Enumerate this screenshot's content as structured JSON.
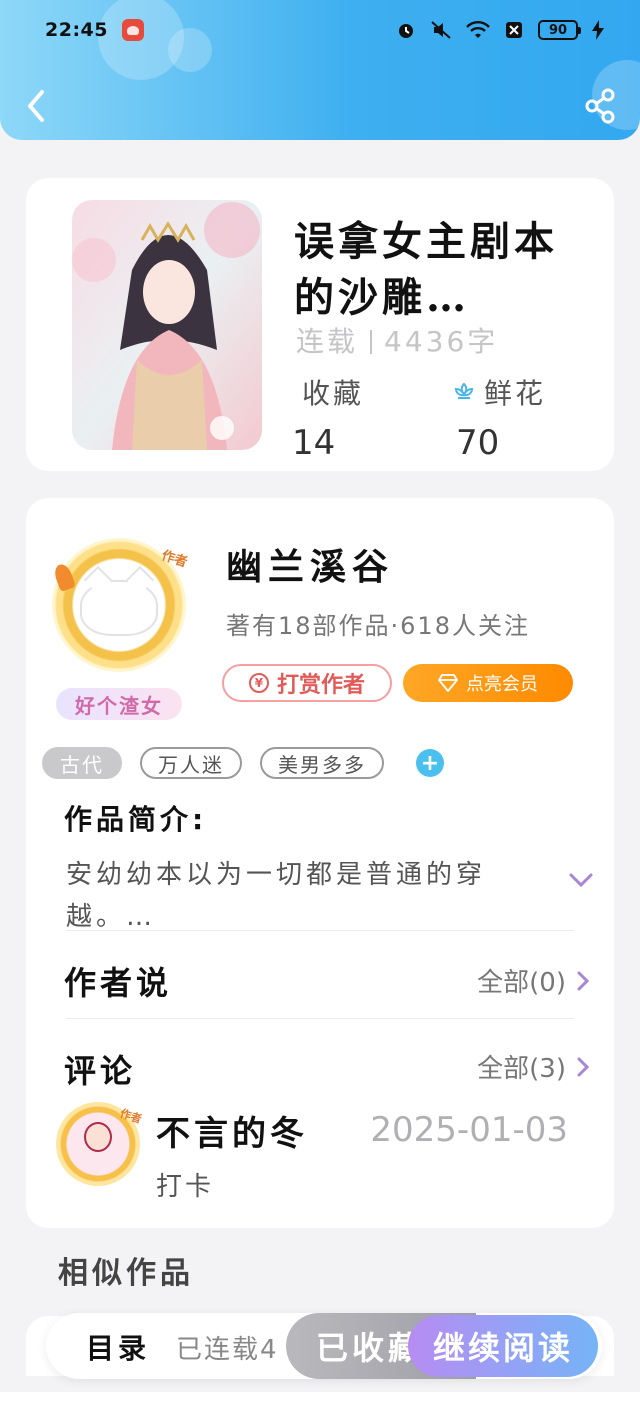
{
  "status_bar": {
    "time": "22:45",
    "battery": "90"
  },
  "header": {
    "back_icon": "chevron-left-icon",
    "share_icon": "share-icon"
  },
  "book": {
    "title": "误拿女主剧本的沙雕…",
    "status": "连载",
    "word_count": "4436字",
    "favorites_label": "收藏",
    "favorites_value": "14",
    "flowers_label": "鲜花",
    "flowers_value": "70"
  },
  "author": {
    "name": "幽兰溪谷",
    "info": "著有18部作品·618人关注",
    "avatar_tag": "作者",
    "badge": "好个渣女",
    "reward_label": "打赏作者",
    "vip_label": "点亮会员"
  },
  "tags": [
    "古代",
    "万人迷",
    "美男多多"
  ],
  "intro": {
    "title": "作品简介:",
    "text": "安幼幼本以为一切都是普通的穿越。…"
  },
  "author_says": {
    "title": "作者说",
    "link": "全部(0)"
  },
  "comments": {
    "title": "评论",
    "link": "全部(3)",
    "items": [
      {
        "name": "不言的冬",
        "date": "2025-01-03",
        "text": "打卡",
        "avatar_tag": "作者"
      }
    ]
  },
  "similar": {
    "title": "相似作品"
  },
  "bottom_bar": {
    "toc": "目录",
    "serial_status": "已连载4",
    "favorited": "已收藏",
    "continue_read": "继续阅读"
  },
  "colors": {
    "header_gradient_start": "#8ed8f8",
    "header_gradient_end": "#33a8f0",
    "vip_orange": "#ff8a00",
    "reward_red": "#e25b5b",
    "read_gradient_start": "#b78cf2",
    "read_gradient_end": "#76b4f7",
    "tag_add_blue": "#49c0ee"
  }
}
